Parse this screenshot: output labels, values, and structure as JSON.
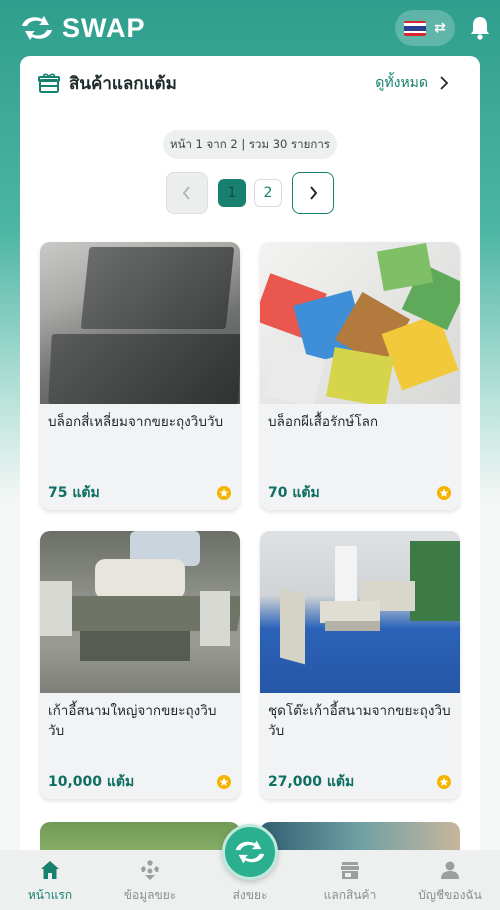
{
  "header": {
    "brand": "SWAP",
    "language_flag": "thai-flag-icon"
  },
  "section": {
    "title": "สินค้าแลกแต้ม",
    "see_all": "ดูทั้งหมด"
  },
  "pagination": {
    "info": "หน้า 1 จาก 2 | รวม 30 รายการ",
    "current_page": "1",
    "next_page": "2"
  },
  "products": [
    {
      "name": "บล็อกสี่เหลี่ยมจากขยะถุงวิบวับ",
      "points": "75 แต้ม"
    },
    {
      "name": "บล็อกผีเสื้อรักษ์โลก",
      "points": "70 แต้ม"
    },
    {
      "name": "เก้าอี้สนามใหญ่จากขยะถุงวิบวับ",
      "points": "10,000 แต้ม"
    },
    {
      "name": "ชุดโต๊ะเก้าอี้สนามจากขยะถุงวิบวับ",
      "points": "27,000 แต้ม"
    }
  ],
  "nav": {
    "home": "หน้าแรก",
    "waste_info": "ข้อมูลขยะ",
    "send_waste": "ส่งขยะ",
    "redeem": "แลกสินค้า",
    "account": "บัญชีของฉัน"
  },
  "colors": {
    "primary": "#17806e",
    "header_gradient_top": "#2f9e8d",
    "points_text": "#0e6f62",
    "star": "#f5b400"
  }
}
